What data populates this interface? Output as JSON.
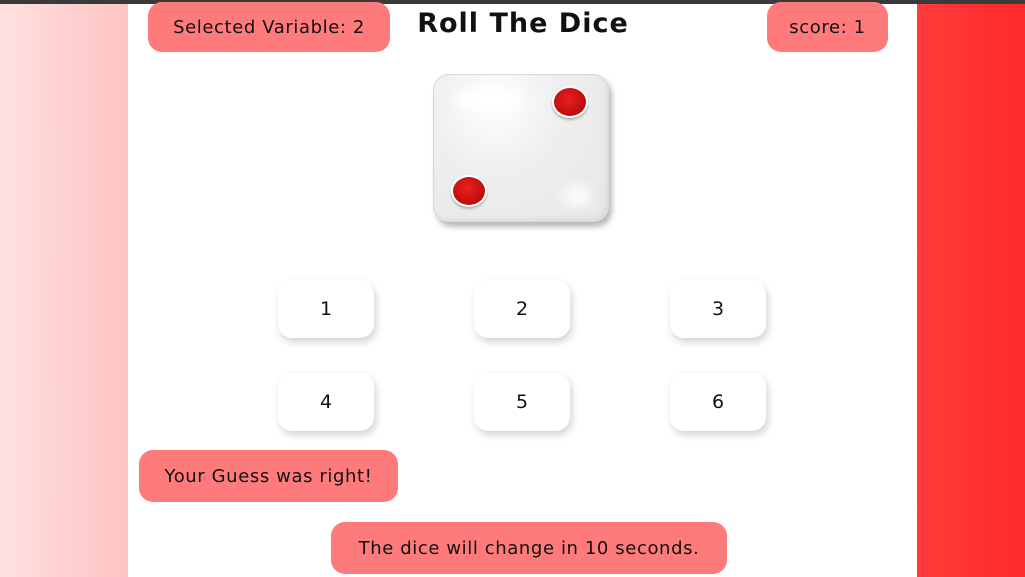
{
  "header": {
    "selected_variable": "Selected Variable: 2",
    "title": "Roll The Dice",
    "score": "score: 1"
  },
  "dice": {
    "face_value": 2,
    "pip_color": "#d01212",
    "face_color": "#eeeeee"
  },
  "guess_buttons": [
    "1",
    "2",
    "3",
    "4",
    "5",
    "6"
  ],
  "messages": {
    "result": "Your Guess was right!",
    "timer": "The dice will change in 10 seconds."
  },
  "colors": {
    "accent": "#ff7b7b",
    "background_gradient_end": "#ff2a2a"
  }
}
